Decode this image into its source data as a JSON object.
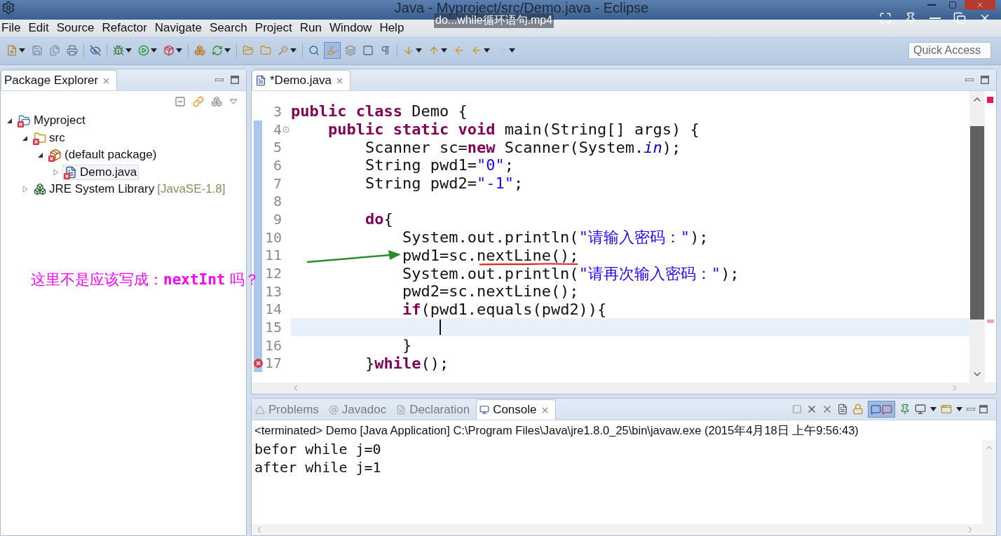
{
  "window": {
    "title": "Java - Myproject/src/Demo.java - Eclipse"
  },
  "video_overlay": {
    "title": "do...while循环语句.mp4"
  },
  "menu": [
    "File",
    "Edit",
    "Source",
    "Refactor",
    "Navigate",
    "Search",
    "Project",
    "Run",
    "Window",
    "Help"
  ],
  "toolbar": {
    "toggle_pressed": true
  },
  "quick_access": {
    "placeholder": "Quick Access"
  },
  "package_explorer": {
    "title": "Package Explorer",
    "tree": [
      {
        "label": "Myproject",
        "kind": "project",
        "error": true,
        "expanded": true,
        "selected": false,
        "children": [
          {
            "label": "src",
            "kind": "folder",
            "error": true,
            "expanded": true,
            "selected": false,
            "children": [
              {
                "label": "(default package)",
                "kind": "package",
                "error": true,
                "expanded": true,
                "selected": false,
                "children": [
                  {
                    "label": "Demo.java",
                    "kind": "file",
                    "error": true,
                    "expanded": false,
                    "selected": true
                  }
                ]
              }
            ]
          },
          {
            "label": "JRE System Library",
            "decoration": "[JavaSE-1.8]",
            "kind": "library",
            "error": false,
            "expanded": false,
            "selected": false
          }
        ]
      }
    ]
  },
  "editor": {
    "tab": "*Demo.java",
    "lines": [
      {
        "number": "3",
        "changed": false,
        "current": false,
        "foldable": false,
        "error": false,
        "tokens": [
          {
            "kind": "kw",
            "text": "public"
          },
          {
            "kind": "kw",
            "text": " class"
          },
          {
            "kind": "plain",
            "text": " Demo {"
          }
        ]
      },
      {
        "number": "4",
        "changed": true,
        "current": false,
        "foldable": true,
        "error": false,
        "tokens": [
          {
            "kind": "kw",
            "text": "    public"
          },
          {
            "kind": "kw",
            "text": " static"
          },
          {
            "kind": "kw",
            "text": " void"
          },
          {
            "kind": "plain",
            "text": " main(String[] args) {"
          }
        ]
      },
      {
        "number": "5",
        "changed": true,
        "current": false,
        "foldable": false,
        "error": false,
        "tokens": [
          {
            "kind": "plain",
            "text": "        Scanner sc="
          },
          {
            "kind": "kw",
            "text": "new"
          },
          {
            "kind": "plain",
            "text": " Scanner(System."
          },
          {
            "kind": "field",
            "text": "in"
          },
          {
            "kind": "plain",
            "text": ");"
          }
        ]
      },
      {
        "number": "6",
        "changed": true,
        "current": false,
        "foldable": false,
        "error": false,
        "tokens": [
          {
            "kind": "plain",
            "text": "        String pwd1="
          },
          {
            "kind": "str",
            "text": "\"0\""
          },
          {
            "kind": "plain",
            "text": ";"
          }
        ]
      },
      {
        "number": "7",
        "changed": true,
        "current": false,
        "foldable": false,
        "error": false,
        "tokens": [
          {
            "kind": "plain",
            "text": "        String pwd2="
          },
          {
            "kind": "str",
            "text": "\"-1\""
          },
          {
            "kind": "plain",
            "text": ";"
          }
        ]
      },
      {
        "number": "8",
        "changed": true,
        "current": false,
        "foldable": false,
        "error": false
      },
      {
        "number": "9",
        "changed": true,
        "current": false,
        "foldable": false,
        "error": false,
        "tokens": [
          {
            "kind": "kw",
            "text": "        do"
          },
          {
            "kind": "plain",
            "text": "{"
          }
        ]
      },
      {
        "number": "10",
        "changed": true,
        "current": false,
        "foldable": false,
        "error": false,
        "tokens": [
          {
            "kind": "plain",
            "text": "            System.out.println("
          },
          {
            "kind": "str",
            "text": "\"请输入密码：\""
          },
          {
            "kind": "plain",
            "text": ");"
          }
        ]
      },
      {
        "number": "11",
        "changed": true,
        "current": false,
        "foldable": false,
        "error": false,
        "tokens": [
          {
            "kind": "plain",
            "text": "            pwd1=sc.nextLine();"
          }
        ]
      },
      {
        "number": "12",
        "changed": true,
        "current": false,
        "foldable": false,
        "error": false,
        "tokens": [
          {
            "kind": "plain",
            "text": "            System.out.println("
          },
          {
            "kind": "str",
            "text": "\"请再次输入密码：\""
          },
          {
            "kind": "plain",
            "text": ");"
          }
        ]
      },
      {
        "number": "13",
        "changed": true,
        "current": false,
        "foldable": false,
        "error": false,
        "tokens": [
          {
            "kind": "plain",
            "text": "            pwd2=sc.nextLine();"
          }
        ]
      },
      {
        "number": "14",
        "changed": true,
        "current": false,
        "foldable": false,
        "error": false,
        "tokens": [
          {
            "kind": "kw",
            "text": "            if"
          },
          {
            "kind": "plain",
            "text": "(pwd1.equals(pwd2)){"
          }
        ]
      },
      {
        "number": "15",
        "changed": true,
        "current": true,
        "foldable": false,
        "error": false
      },
      {
        "number": "16",
        "changed": true,
        "current": false,
        "foldable": false,
        "error": false,
        "tokens": [
          {
            "kind": "plain",
            "text": "            }"
          }
        ]
      },
      {
        "number": "17",
        "changed": true,
        "current": false,
        "foldable": false,
        "error": true,
        "tokens": [
          {
            "kind": "plain",
            "text": "        }"
          },
          {
            "kind": "kw",
            "text": "while"
          },
          {
            "kind": "plain",
            "text": "();"
          }
        ]
      }
    ]
  },
  "annotation": {
    "text": "这里不是应该写成：**nextInt** 吗？"
  },
  "console": {
    "tabs": [
      {
        "label": "Problems",
        "selected": false
      },
      {
        "label": "Javadoc",
        "selected": false
      },
      {
        "label": "Declaration",
        "selected": false
      },
      {
        "label": "Console",
        "selected": true
      }
    ],
    "toggles_pressed": true,
    "status": "<terminated> Demo [Java Application] C:\\Program Files\\Java\\jre1.8.0_25\\bin\\javaw.exe (2015年4月18日 上午9:56:43)",
    "output": [
      "befor while j=0",
      "after while j=1"
    ]
  }
}
